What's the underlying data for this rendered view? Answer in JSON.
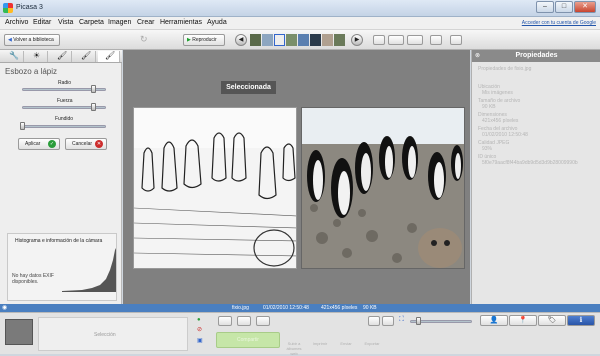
{
  "window": {
    "title": "Picasa 3"
  },
  "menu": {
    "items": [
      "Archivo",
      "Editar",
      "Vista",
      "Carpeta",
      "Imagen",
      "Crear",
      "Herramientas",
      "Ayuda"
    ],
    "signin": "Acceder con tu cuenta de Google"
  },
  "toolbar": {
    "back_label": "Volver a biblioteca",
    "play_label": "Reproducir"
  },
  "effect": {
    "title": "Esbozo a lápiz",
    "sliders": [
      {
        "label": "Radio",
        "value": 0.88
      },
      {
        "label": "Fuerza",
        "value": 0.88
      },
      {
        "label": "Fundido",
        "value": 0.02
      }
    ],
    "apply_label": "Aplicar",
    "cancel_label": "Cancelar"
  },
  "histogram": {
    "title": "Histograma e información de la cámara",
    "note": "No hay datos EXIF disponibles."
  },
  "viewer": {
    "selected_label": "Seleccionada"
  },
  "properties": {
    "header": "Propiedades",
    "subtitle": "Propiedades de fixio.jpg",
    "items": [
      {
        "label": "Ubicación",
        "value": "Mis imágenes"
      },
      {
        "label": "Tamaño de archivo",
        "value": "90 KB"
      },
      {
        "label": "Dimensiones",
        "value": "421x456 píxeles"
      },
      {
        "label": "Fecha del archivo",
        "value": "01/02/2010 12:50:48"
      },
      {
        "label": "Calidad JPEG",
        "value": "93%"
      },
      {
        "label": "ID único",
        "value": "5f0e79aacf8f44ba9db9d5d3d9b28009990b"
      }
    ]
  },
  "status": {
    "file": "fixio.jpg",
    "date": "01/02/2010 12:50:48",
    "dims": "421x456 píxeles",
    "size": "90 KB"
  },
  "bottom": {
    "selection_label": "Selección",
    "upload_label": "Compartir",
    "buttons": [
      "Subir a álbumes web",
      "Imprimir",
      "Enviar",
      "Exportar"
    ]
  }
}
